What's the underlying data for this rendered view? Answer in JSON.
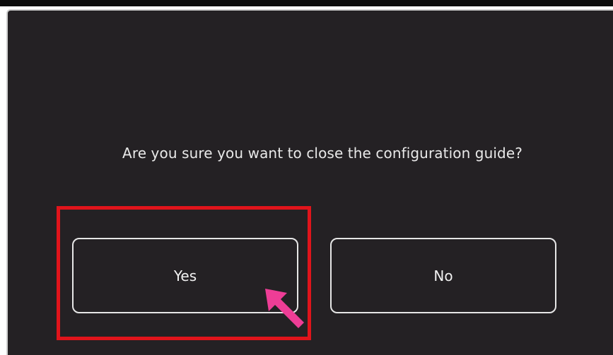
{
  "dialog": {
    "message": "Are you sure you want to close the configuration guide?",
    "yes_label": "Yes",
    "no_label": "No"
  },
  "annotation": {
    "highlight_color": "#e0141b",
    "arrow_color": "#ee3d96",
    "highlighted_target": "yes-button"
  },
  "colors": {
    "dialog_background": "#242124",
    "text": "#e9e9e9"
  }
}
